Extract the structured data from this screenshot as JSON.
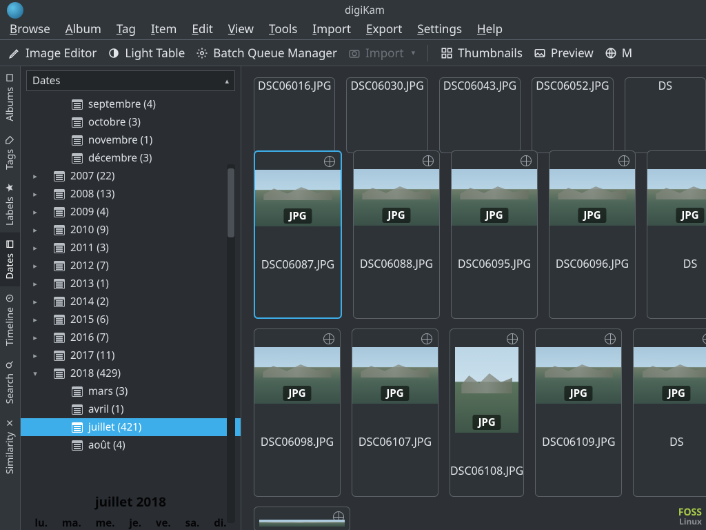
{
  "app": {
    "title": "digiKam"
  },
  "menus": [
    "Browse",
    "Album",
    "Tag",
    "Item",
    "Edit",
    "View",
    "Tools",
    "Import",
    "Export",
    "Settings",
    "Help"
  ],
  "toolbar": {
    "image_editor": "Image Editor",
    "light_table": "Light Table",
    "batch_queue": "Batch Queue Manager",
    "import": "Import",
    "thumbnails": "Thumbnails",
    "preview": "Preview",
    "map": "M"
  },
  "left_tabs": [
    "Albums",
    "Tags",
    "Labels",
    "Dates",
    "Timeline",
    "Search",
    "Similarity"
  ],
  "left_tabs_active": "Dates",
  "panel": {
    "title": "Dates"
  },
  "tree": {
    "leading_months": [
      {
        "label": "septembre (4)"
      },
      {
        "label": "octobre (3)"
      },
      {
        "label": "novembre (1)"
      },
      {
        "label": "décembre (3)"
      }
    ],
    "years": [
      {
        "label": "2007 (22)"
      },
      {
        "label": "2008 (13)"
      },
      {
        "label": "2009 (4)"
      },
      {
        "label": "2010 (9)"
      },
      {
        "label": "2011 (3)"
      },
      {
        "label": "2012 (7)"
      },
      {
        "label": "2013 (1)"
      },
      {
        "label": "2014 (2)"
      },
      {
        "label": "2015 (6)"
      },
      {
        "label": "2016 (7)"
      },
      {
        "label": "2017 (11)"
      }
    ],
    "expanded_year": {
      "label": "2018 (429)",
      "months": [
        {
          "label": "mars (3)"
        },
        {
          "label": "avril (1)"
        },
        {
          "label": "juillet (421)",
          "selected": true
        },
        {
          "label": "août (4)"
        }
      ]
    }
  },
  "calendar": {
    "title": "juillet 2018",
    "days": [
      "lu.",
      "ma.",
      "me.",
      "je.",
      "ve.",
      "sa.",
      "di."
    ]
  },
  "thumbs": {
    "badge": "JPG",
    "row0": [
      "DSC06016.JPG",
      "DSC06030.JPG",
      "DSC06043.JPG",
      "DSC06052.JPG",
      "DS"
    ],
    "row1": [
      {
        "name": "DSC06087.JPG",
        "selected": true
      },
      {
        "name": "DSC06088.JPG"
      },
      {
        "name": "DSC06095.JPG"
      },
      {
        "name": "DSC06096.JPG"
      },
      {
        "name": "DS"
      }
    ],
    "row2": [
      {
        "name": "DSC06098.JPG"
      },
      {
        "name": "DSC06107.JPG"
      },
      {
        "name": "DSC06108.JPG",
        "tall": true
      },
      {
        "name": "DSC06109.JPG"
      },
      {
        "name": "DS"
      }
    ]
  },
  "watermark": {
    "line1": "FOSS",
    "line2": "Linux"
  }
}
